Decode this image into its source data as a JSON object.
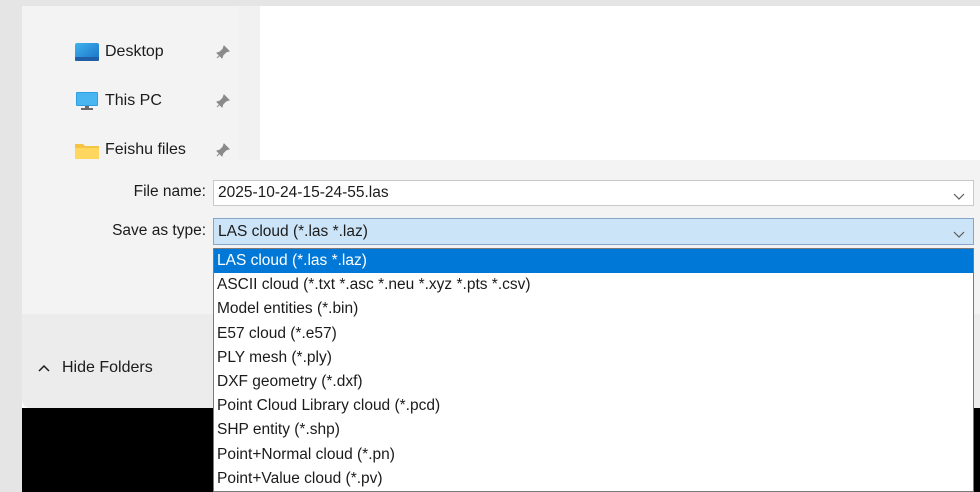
{
  "nav": {
    "items": [
      {
        "label": "Desktop",
        "icon": "desktop-icon"
      },
      {
        "label": "This PC",
        "icon": "this-pc-icon"
      },
      {
        "label": "Feishu files",
        "icon": "folder-icon"
      }
    ]
  },
  "form": {
    "file_name_label": "File name:",
    "file_name_value": "2025-10-24-15-24-55.las",
    "save_type_label": "Save as type:",
    "save_type_value": "LAS cloud (*.las *.laz)"
  },
  "dropdown": {
    "options": [
      "LAS cloud (*.las *.laz)",
      "ASCII cloud (*.txt *.asc *.neu *.xyz *.pts *.csv)",
      "Model entities (*.bin)",
      "E57 cloud (*.e57)",
      "PLY mesh (*.ply)",
      "DXF geometry (*.dxf)",
      "Point Cloud Library cloud (*.pcd)",
      "SHP entity (*.shp)",
      "Point+Normal cloud (*.pn)",
      "Point+Value cloud (*.pv)"
    ],
    "selected_index": 0
  },
  "bottom": {
    "hide_folders_label": "Hide Folders"
  },
  "colors": {
    "accent": "#0078d7",
    "select_bg": "#cce4f7"
  }
}
